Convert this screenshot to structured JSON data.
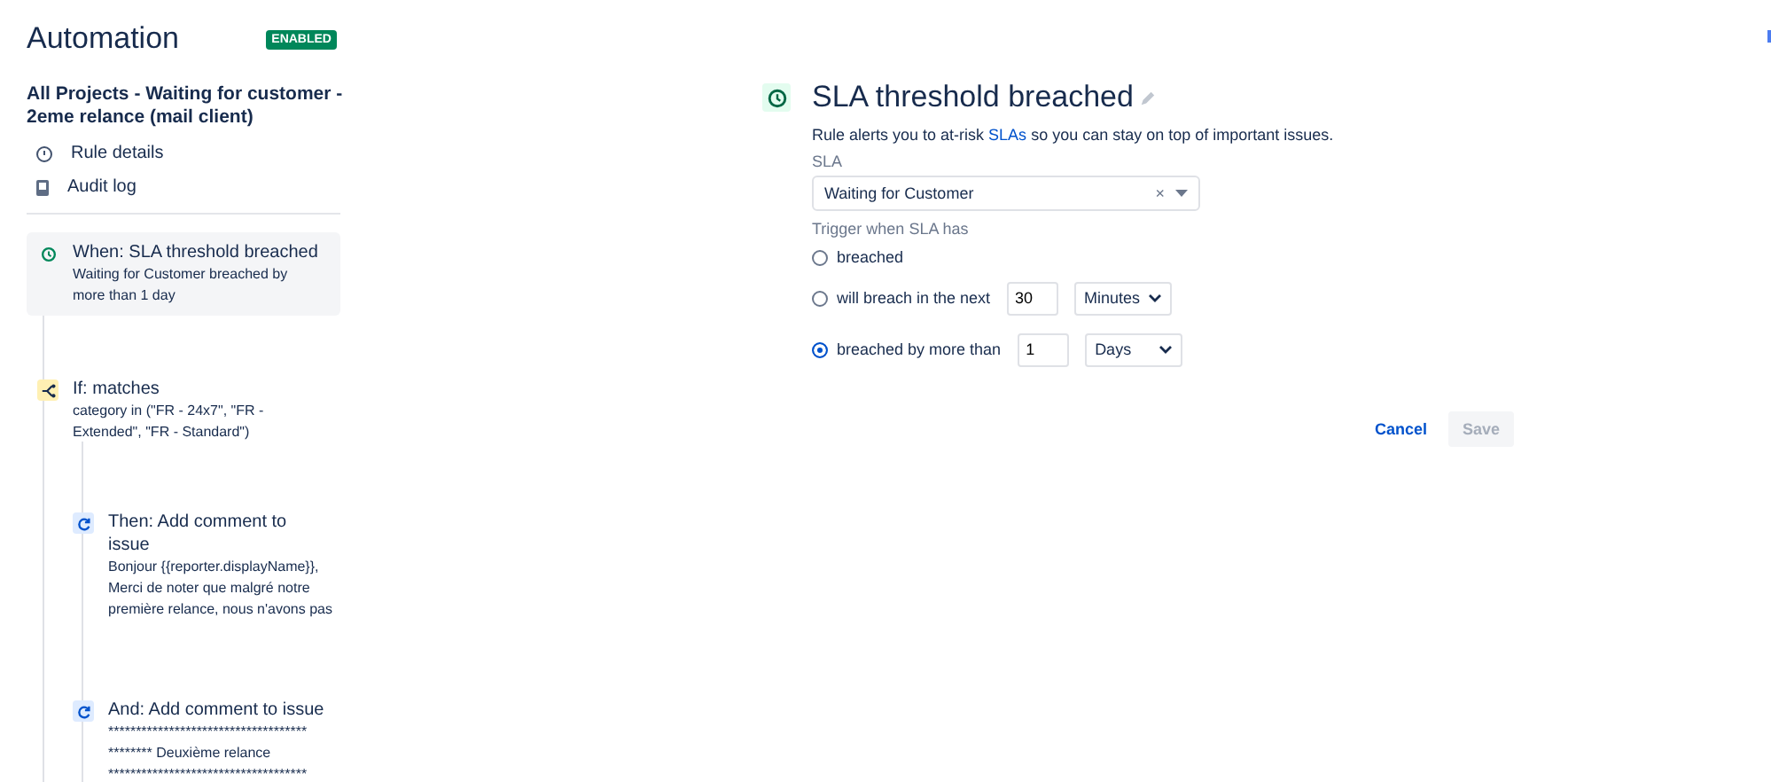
{
  "header": {
    "title": "Automation",
    "status": "ENABLED",
    "enabled": true
  },
  "rule_name": "All Projects - Waiting for customer - 2eme relance (mail client)",
  "nav": [
    {
      "kind": "details",
      "label": "Rule details"
    },
    {
      "kind": "log",
      "label": "Audit log"
    }
  ],
  "steps": [
    {
      "kind": "trigger",
      "selected": true,
      "title": "When: SLA threshold breached",
      "summary": "Waiting for Customer breached by more than 1 day"
    },
    {
      "kind": "condition",
      "selected": false,
      "title": "If: matches",
      "summary": "category in (\"FR - 24x7\", \"FR - Extended\", \"FR - Standard\")",
      "children": [
        {
          "kind": "action",
          "selected": false,
          "title": "Then: Add comment to issue",
          "summary_lines": [
            "Bonjour {{reporter.displayName}},",
            "Merci de noter que malgré notre",
            "première relance, nous n'avons pas"
          ]
        },
        {
          "kind": "action",
          "selected": false,
          "title": "And: Add comment to issue",
          "summary_lines": [
            "************************************",
            "******** Deuxième relance",
            "************************************"
          ]
        }
      ]
    }
  ],
  "panel": {
    "title": "SLA threshold breached",
    "description_before": "Rule alerts you to at-risk ",
    "description_link": "SLAs",
    "description_after": " so you can stay on top of important issues.",
    "sla_label": "SLA",
    "sla_value": "Waiting for Customer",
    "clear_symbol": "×",
    "trigger_label": "Trigger when SLA has",
    "options": [
      {
        "kind": "plain",
        "label": "breached",
        "selected": false
      },
      {
        "kind": "amount",
        "label": "will breach in the next",
        "selected": false,
        "amount": "30",
        "unit": "Minutes"
      },
      {
        "kind": "amount",
        "label": "breached by more than",
        "selected": true,
        "amount": "1",
        "unit": "Days"
      }
    ],
    "buttons": [
      {
        "kind": "link",
        "label": "Cancel",
        "disabled": false
      },
      {
        "kind": "primary",
        "label": "Save",
        "disabled": true
      }
    ]
  }
}
